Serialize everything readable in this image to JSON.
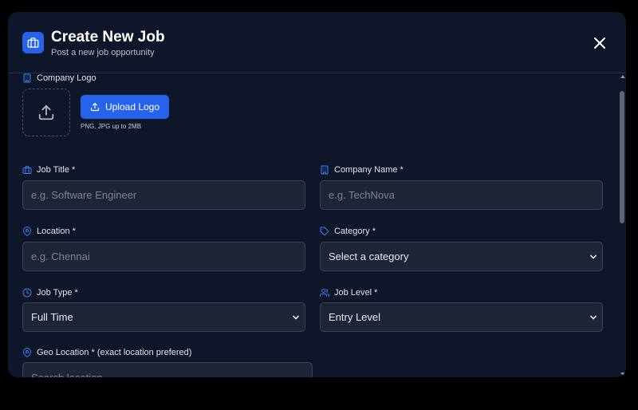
{
  "header": {
    "title": "Create New Job",
    "subtitle": "Post a new job opportunity",
    "icon": "briefcase-icon",
    "close_icon": "close-icon"
  },
  "company_logo": {
    "label": "Company Logo",
    "upload_button": "Upload Logo",
    "hint": "PNG, JPG up to 2MB"
  },
  "fields": {
    "job_title": {
      "label": "Job Title *",
      "placeholder": "e.g. Software Engineer"
    },
    "company_name": {
      "label": "Company Name *",
      "placeholder": "e.g. TechNova"
    },
    "location": {
      "label": "Location *",
      "placeholder": "e.g. Chennai"
    },
    "category": {
      "label": "Category *",
      "value": "Select a category"
    },
    "job_type": {
      "label": "Job Type *",
      "value": "Full Time"
    },
    "job_level": {
      "label": "Job Level *",
      "value": "Entry Level"
    },
    "geo_location": {
      "label": "Geo Location * (exact location prefered)",
      "placeholder": "Search location"
    }
  },
  "colors": {
    "accent": "#2563eb",
    "modal_bg": "#0f1629",
    "field_bg": "#1d2537",
    "icon_blue": "#3b82f6"
  }
}
